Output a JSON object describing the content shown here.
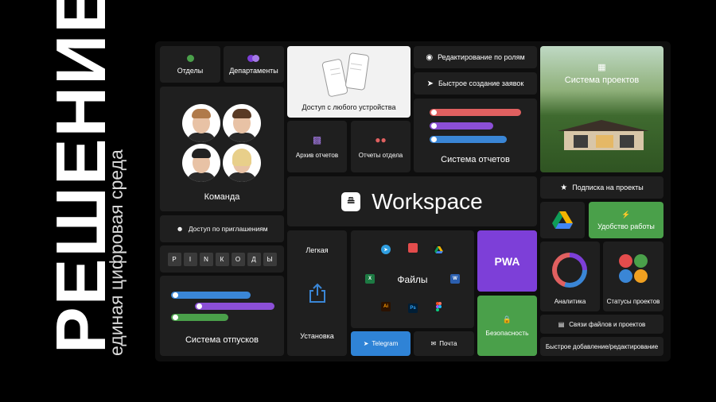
{
  "side": {
    "title": "РЕШЕНИЕ",
    "subtitle": "единая цифровая среда"
  },
  "cards": {
    "departments_short": "Отделы",
    "departments": "Департаменты",
    "devices": "Доступ с любого устройства",
    "role_edit": "Редактирование по ролям",
    "quick_requests": "Быстрое создание заявок",
    "projects_system": "Система проектов",
    "team": "Команда",
    "reports_archive": "Архив отчетов",
    "dept_reports": "Отчеты отдела",
    "reports_system": "Система отчетов",
    "workspace": "Workspace",
    "subscription": "Подписка на проекты",
    "convenience": "Удобство работы",
    "invite_access": "Доступ по приглашениям",
    "pincodes": [
      "P",
      "I",
      "N",
      "К",
      "О",
      "Д",
      "Ы"
    ],
    "easy": "Легкая",
    "install": "Установка",
    "files": "Файлы",
    "pwa": "PWA",
    "analytics": "Аналитика",
    "project_statuses": "Статусы проектов",
    "vacations": "Система отпусков",
    "security": "Безопасность",
    "file_links": "Связи файлов и проектов",
    "quick_edit": "Быстрое добавление/редактирование",
    "telegram": "Telegram",
    "mail": "Почта"
  },
  "file_icons": [
    "Ai",
    "Ps"
  ],
  "colors": {
    "accent_purple": "#7d3fd8",
    "green": "#4aa04a",
    "telegram_blue": "#2f83d6",
    "report_red": "#e06060",
    "report_purple": "#8b4fd6",
    "report_blue": "#3a86d6"
  }
}
